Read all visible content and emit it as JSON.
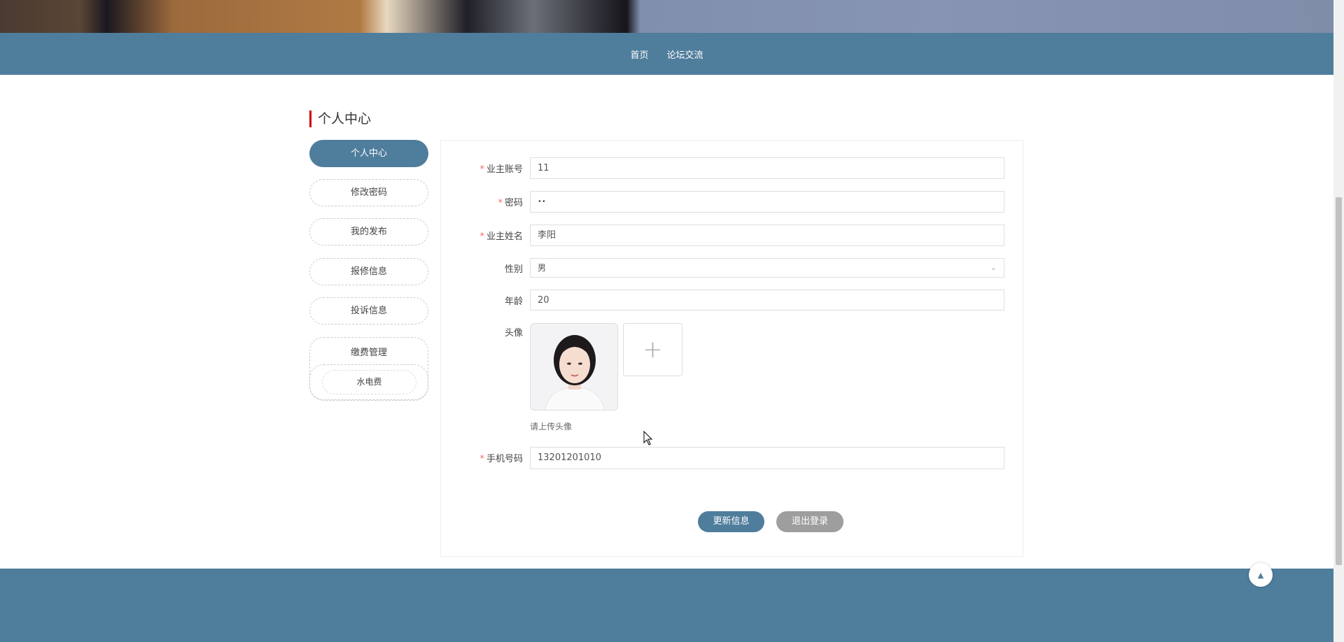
{
  "nav": {
    "items": [
      "首页",
      "论坛交流"
    ]
  },
  "page_title": "个人中心",
  "sidebar": {
    "items": [
      "个人中心",
      "修改密码",
      "我的发布",
      "报修信息",
      "投诉信息"
    ],
    "group": {
      "label": "缴费管理",
      "sub": [
        "水电费"
      ]
    }
  },
  "form": {
    "account": {
      "label": "业主账号",
      "value": "11"
    },
    "password": {
      "label": "密码",
      "value": "••"
    },
    "name": {
      "label": "业主姓名",
      "value": "李阳"
    },
    "gender": {
      "label": "性别",
      "value": "男"
    },
    "age": {
      "label": "年龄",
      "value": "20"
    },
    "avatar": {
      "label": "头像",
      "hint": "请上传头像"
    },
    "phone": {
      "label": "手机号码",
      "value": "13201201010"
    },
    "update_label": "更新信息",
    "logout_label": "退出登录"
  },
  "colors": {
    "primary": "#4f7d9c",
    "required": "#f56c6c",
    "accent_bar": "#cc0000",
    "logout": "#9e9e9e"
  }
}
